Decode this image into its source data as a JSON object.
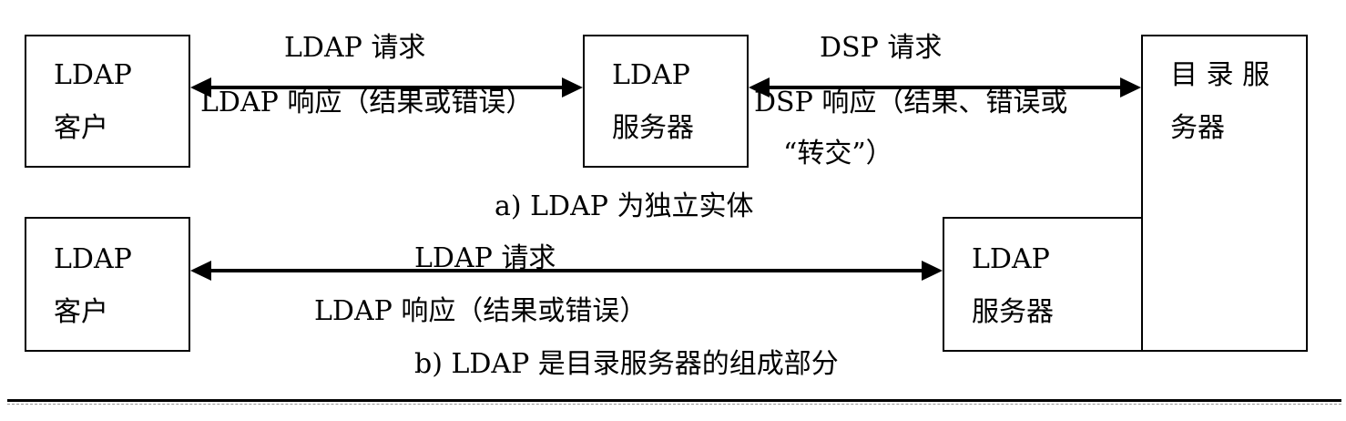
{
  "diagram_a": {
    "client": {
      "line1": "LDAP",
      "line2": "客户"
    },
    "server": {
      "line1": "LDAP",
      "line2": "服务器"
    },
    "request_label": "LDAP 请求",
    "response_label": "LDAP 响应（结果或错误）",
    "dsp_request_label": "DSP 请求",
    "dsp_response_line1": "DSP 响应（结果、错误或",
    "dsp_response_line2": "“转交”）",
    "caption": "a) LDAP 为独立实体"
  },
  "directory_server": {
    "line1": "目 录 服",
    "line2": "务器"
  },
  "diagram_b": {
    "client": {
      "line1": "LDAP",
      "line2": "客户"
    },
    "server": {
      "line1": "LDAP",
      "line2": "服务器"
    },
    "request_label": "LDAP 请求",
    "response_label": "LDAP 响应（结果或错误）",
    "caption": "b) LDAP 是目录服务器的组成部分"
  },
  "colors": {
    "ink": "#000000",
    "background": "#ffffff"
  }
}
